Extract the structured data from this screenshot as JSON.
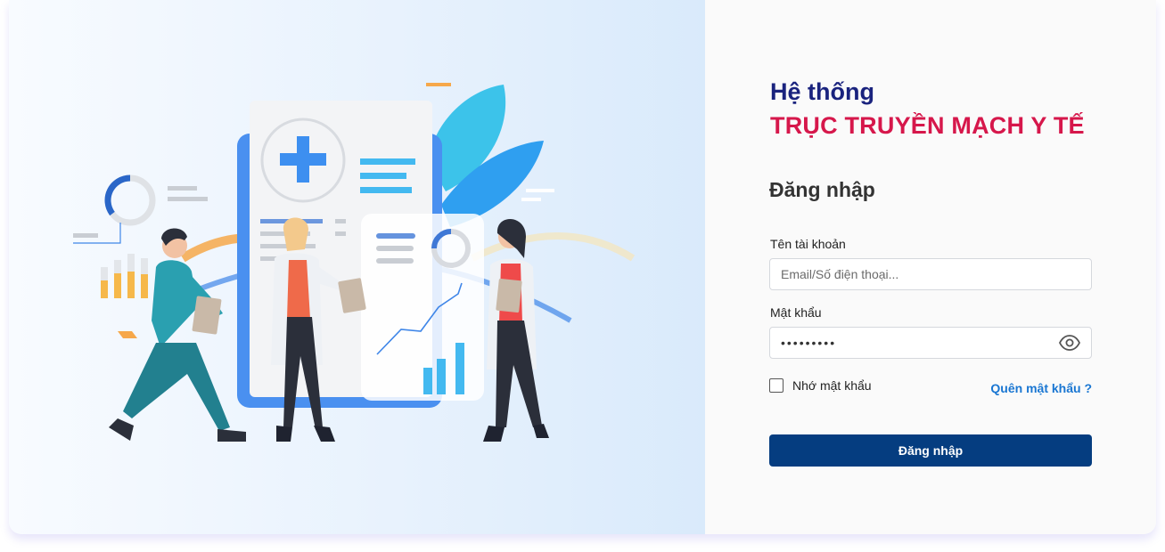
{
  "brand": {
    "title_line1": "Hệ thống",
    "title_line2": "TRỤC TRUYỀN MẠCH Y TẾ"
  },
  "form": {
    "heading": "Đăng nhập",
    "username_label": "Tên tài khoản",
    "username_placeholder": "Email/Số điện thoại...",
    "username_value": "",
    "password_label": "Mật khẩu",
    "password_value": "123456789",
    "show_password_icon": "eye-icon",
    "remember_label": "Nhớ mật khẩu",
    "remember_checked": false,
    "forgot_link": "Quên mật khẩu ?",
    "submit_label": "Đăng nhập"
  },
  "colors": {
    "title_primary": "#1a237e",
    "title_accent": "#d6174b",
    "button": "#053d80",
    "link": "#1976d2"
  },
  "illustration": {
    "name": "medical-team-illustration"
  }
}
